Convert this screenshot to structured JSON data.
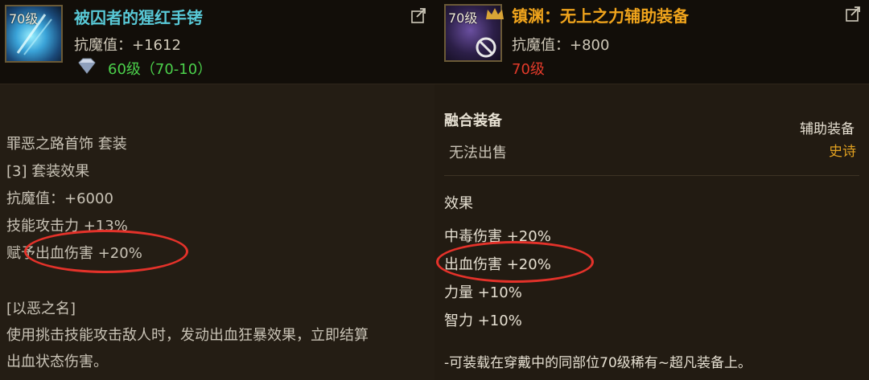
{
  "left_item": {
    "level_badge": "70级",
    "name": "被囚者的猩红手铐",
    "stat": "抗魔值：+1612",
    "level_req": "60级（70-10）",
    "set_name": "罪恶之路首饰 套装",
    "set_effect_header": "[3] 套装效果",
    "set_stats": [
      "抗魔值：+6000",
      "技能攻击力 +13%",
      "赋予出血伤害 +20%"
    ],
    "skill_name": "[以恶之名]",
    "skill_desc": [
      "使用挑击技能攻击敌人时，发动出血狂暴效果，立即结算",
      "出血状态伤害。"
    ]
  },
  "right_item": {
    "level_badge": "70级",
    "name": "镇渊：无上之力辅助装备",
    "stat": "抗魔值：+800",
    "level_req": "70级",
    "fusion_label": "融合装备",
    "trade_note": "无法出售",
    "item_type": "辅助装备",
    "rarity": "史诗",
    "effects_header": "效果",
    "effects": [
      "中毒伤害 +20%",
      "出血伤害 +20%",
      "力量 +10%",
      "智力 +10%"
    ],
    "footnote": "-可装载在穿戴中的同部位70级稀有~超凡装备上。"
  },
  "colors": {
    "title_cyan": "#58c8d6",
    "title_orange": "#f0a41c",
    "level_green": "#4bd04b",
    "level_red": "#e23a2a",
    "highlight_ring": "#e4322a",
    "rarity_gold": "#e0a020"
  },
  "icons": {
    "left_item_icon": "bracelet-blue-glow-icon",
    "right_item_icon": "dark-crystal-icon",
    "share": "share-icon",
    "gem": "gem-icon",
    "crown": "crown-icon",
    "no_trade": "no-trade-icon"
  }
}
